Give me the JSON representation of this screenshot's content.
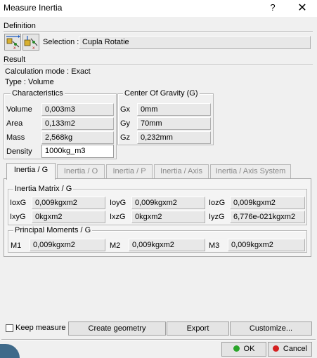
{
  "window": {
    "title": "Measure Inertia",
    "help": "?",
    "close": "✕"
  },
  "definition": {
    "label": "Definition",
    "selection_label": "Selection :",
    "selection_value": "Cupla Rotatie"
  },
  "result": {
    "label": "Result",
    "calc_mode": "Calculation mode : Exact",
    "type": "Type : Volume"
  },
  "characteristics": {
    "title": "Characteristics",
    "rows": [
      {
        "label": "Volume",
        "value": "0,003m3"
      },
      {
        "label": "Area",
        "value": "0,133m2"
      },
      {
        "label": "Mass",
        "value": "2,568kg"
      },
      {
        "label": "Density",
        "value": "1000kg_m3"
      }
    ]
  },
  "cog": {
    "title": "Center Of Gravity (G)",
    "rows": [
      {
        "label": "Gx",
        "value": "0mm"
      },
      {
        "label": "Gy",
        "value": "70mm"
      },
      {
        "label": "Gz",
        "value": "0,232mm"
      }
    ]
  },
  "tabs": [
    "Inertia / G",
    "Inertia / O",
    "Inertia / P",
    "Inertia / Axis",
    "Inertia / Axis System"
  ],
  "inertia_matrix": {
    "title": "Inertia Matrix / G",
    "cells": [
      {
        "label": "IoxG",
        "value": "0,009kgxm2"
      },
      {
        "label": "IoyG",
        "value": "0,009kgxm2"
      },
      {
        "label": "IozG",
        "value": "0,009kgxm2"
      },
      {
        "label": "IxyG",
        "value": "0kgxm2"
      },
      {
        "label": "IxzG",
        "value": "0kgxm2"
      },
      {
        "label": "IyzG",
        "value": "6,776e-021kgxm2"
      }
    ]
  },
  "principal_moments": {
    "title": "Principal Moments / G",
    "cells": [
      {
        "label": "M1",
        "value": "0,009kgxm2"
      },
      {
        "label": "M2",
        "value": "0,009kgxm2"
      },
      {
        "label": "M3",
        "value": "0,009kgxm2"
      }
    ]
  },
  "bottom": {
    "keep_measure": "Keep measure",
    "create_geometry": "Create geometry",
    "export": "Export",
    "customize": "Customize...",
    "ok": "OK",
    "cancel": "Cancel"
  },
  "colors": {
    "ok_dot": "#2aa52a",
    "cancel_dot": "#d42020"
  }
}
